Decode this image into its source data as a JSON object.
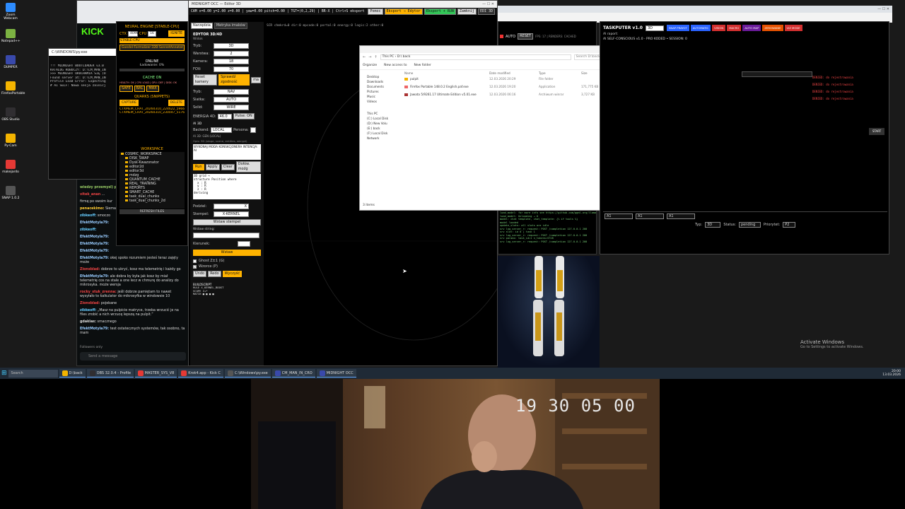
{
  "desktop": {
    "icons": [
      {
        "label": "Zoom Webcam",
        "icon": "camera-icon",
        "color": "#2d8cff"
      },
      {
        "label": "Notepad++",
        "icon": "notepad-icon",
        "color": "#7cb342"
      },
      {
        "label": "DUMPER",
        "icon": "app-icon",
        "color": "#3949ab"
      },
      {
        "label": "FirefoxPortable",
        "icon": "folder-icon",
        "color": "#f4b400"
      },
      {
        "label": "OBS Studio",
        "icon": "obs-icon",
        "color": "#302e31"
      },
      {
        "label": "Py-Cam",
        "icon": "folder-icon",
        "color": "#f4b400"
      },
      {
        "label": "makejardo",
        "icon": "app-icon",
        "color": "#e53935"
      },
      {
        "label": "SNAP 1.0.2",
        "icon": "app-icon",
        "color": "#555555"
      }
    ],
    "activation": {
      "line1": "Activate Windows",
      "line2": "Go to Settings to activate Windows."
    }
  },
  "kick": {
    "logo": "KICK",
    "placeholder": "Send a message",
    "following": "Followers only",
    "messages": [
      {
        "user": "wiedzy przemysl) p",
        "text": "",
        "color": "#9c6"
      },
      {
        "user": "vitek_anan",
        "text": "...",
        "color": "#e44"
      },
      {
        "user": "",
        "text": "firmę po swoim kur",
        "color": "#ddd"
      },
      {
        "user": "penacekimo:",
        "text": "Siema",
        "color": "#fc3"
      },
      {
        "user": "zibkeoff:",
        "text": "smoczo",
        "color": "#6cf"
      },
      {
        "user": "EfektMotyla79:",
        "text": "",
        "color": "#9cf"
      },
      {
        "user": "zibkeoff:",
        "text": "",
        "color": "#6cf"
      },
      {
        "user": "EfektMotyla79:",
        "text": "",
        "color": "#9cf"
      },
      {
        "user": "EfektMotyla79:",
        "text": "",
        "color": "#9cf"
      },
      {
        "user": "EfektMotyla79:",
        "text": "",
        "color": "#9cf"
      },
      {
        "user": "EfektMotyla79:",
        "text": "okej spoko rozumiem jesteś teraz zajęty może",
        "color": "#9cf"
      },
      {
        "user": "Zionsblad:",
        "text": "dobrze to ukryć, kosz ma telemetrię i każdy go",
        "color": "#e44"
      },
      {
        "user": "EfektMotyla79:",
        "text": "ale dobra by była jak kosz by miał telemetrię cos na stale a one lecz w chmurę do analizy do mikrosyka. może wersja",
        "color": "#9cf"
      },
      {
        "user": "rocky_stuk_zrenna:",
        "text": "jeśli dobrze pamiętam to nawet wysyłało to kalkulator do mikrosyfka w windowsie 10",
        "color": "#e44"
      },
      {
        "user": "Zionsblad:",
        "text": "pojebane",
        "color": "#e44"
      },
      {
        "user": "zibkeoff:",
        "text": "„Masz na pulpicie matryce, trzeba wrzucić je na files zrobić a nich wrzucę lepszą na pulpit.”",
        "color": "#6cf"
      },
      {
        "user": "gdaklas:",
        "text": "smacznego",
        "color": "#ddd"
      },
      {
        "user": "EfektMotyla79:",
        "text": "test ostatecznych systemów, tak osobno, ta mam",
        "color": "#9cf"
      }
    ]
  },
  "console": {
    "title": "C:\\WINDOWS\\py.exe",
    "lines": [
      "!!! MIDNIGHT BOOTLOADER v3.0",
      "KATALOG ROBOCZY: D:\\CM_MAN_IN",
      ">>> MIDNIGHT URUCHAMIA SIĘ (O",
      "Found server at: D:\\CM_MAN_IN",
      "Profile Load Error: Expecting",
      "# AI SELF: Nowa sesja zainicj"
    ]
  },
  "neural": {
    "engine_label": "NEURAL ENGINE [STABLE-CPU]",
    "ctx_label": "CTX",
    "ctx_value": "4096",
    "cpu_label": "CPU",
    "cpu_value": "16",
    "stable_label": "STABLE-CPU",
    "ignite_label": "IGNITE",
    "model_value": "Goedel-Formalizer-32B-SonnetAnnotat",
    "status_online": "ONLINE",
    "loading_label": "Ładowanie: 0%",
    "cache_on": "CACHE ON",
    "health_text": "HEALTH: OK | CPU LOAD | GPU: DEF | DISK: OK",
    "safe": "SAFE",
    "bal": "BAL",
    "max": "MAX",
    "quarks_title": "QUARKS (SNIPPETS)",
    "capture": "CAPTURE",
    "delete": "DELETE",
    "quarks": [
      "CTXMEM_CHAT_20260310_224622_5966",
      "CTXMEM_CHAT_20260310_230047_5176"
    ],
    "workspace_title": "WORKSPACE",
    "tree": [
      "COSMIC_WORKSPACE",
      "DISK_SWAP",
      "Dysk-Kwazonator",
      "editor2d",
      "editor3d",
      "mdzg",
      "QUANTUM_CACHE",
      "REAL_TRAINING",
      "REPORTS",
      "SMART_CACHE",
      "task_dual_chunks",
      "task_dual_chunks_2d"
    ],
    "refresh": "REFRESH FILES"
  },
  "editor": {
    "title": "MIDNIGHT OCC — Editor 3D",
    "hud": "CAM x=0.00 y=2.00 z=0.00 | yaw=0.00 pitch=0.00 | TGT=(0,2,29) | BR-X | Ctrl+S eksport",
    "top_buttons": [
      "Pomoc",
      "Eksport → Edytor",
      "Eksport + RUN",
      "Zamknij",
      "EDI 3D"
    ],
    "hud2": "SCR chmkrd=0  dir:0  mpcode:0  portal:0  energy:0  logic:2  other:0",
    "tabs": [
      "Narzędzia",
      "Metryka imaków"
    ],
    "panel_title": "EDYTOR 3D/4D",
    "section_widok": "Widok",
    "tryb_label": "Tryb:",
    "tryb_value": "3D",
    "warstwa_label": "Warstwa:",
    "warstwa_value": "2",
    "kamera_label": "Kamera:",
    "kamera_value": "18",
    "fov_label": "FOV:",
    "fov_value": "70",
    "reset_camera": "Reset kamery",
    "check": "Sprawdź zgodność",
    "more": "ma",
    "tryb2_label": "Tryb:",
    "tryb2_value": "NAV",
    "siatka_label": "Siatka:",
    "siatka_value": "AUTO",
    "solid_label": "Solid:",
    "solid_value": "WIRE",
    "energy_label": "ENERGIA 4D:",
    "energy_value": "46.0",
    "pulse": "Pulse: ON",
    "ai_label": "AI 3D",
    "backend_label": "Backend:",
    "backend_value": "LOCAL",
    "persona_label": "Persona:",
    "ai_status": "AI 3D: GEN (LOCAL)",
    "ai_hint": "Opis: 3D (stage, scene, entities, wkrypt)",
    "ai_prompt": "WYKONAJ MODA KONSKCJONERA INTENCJA: AI",
    "run_buttons": [
      "Run",
      "Apply",
      "Clear",
      "Dołów. moźg"
    ],
    "code_lines": [
      "3D grid →",
      "structure Position where",
      "  x : R",
      "  y : R",
      "  z : R",
      "deriving"
    ],
    "podziel_label": "Podziel:",
    "podziel_value": "X",
    "stempel_label": "Stempel:",
    "stempel_value": "X-KERNEL",
    "wstaw_stempel": "Wstaw stempel",
    "wstaw_string_label": "Wstaw string:",
    "kierunek_label": "Kierunek:",
    "wstaw": "Wstaw",
    "check_ghost": "Ghost Z±1 (G)",
    "check_wzorce": "Wzorce (P)",
    "action_buttons": [
      "Undo",
      "Redo",
      "Wyczyść"
    ],
    "script_title": "BUILDSCRIPT",
    "script_lines": [
      "RULE X_KERNEL_BOOST",
      "SCOPE Z+*",
      "MATCH ■ ■ ■ ■"
    ]
  },
  "explorer": {
    "path": "This PC › D:\\ back",
    "search": "Search D:\\back",
    "ribbon": [
      "Organize",
      "New access to",
      "New folder"
    ],
    "nav": [
      "Desktop",
      "Downloads",
      "Documents",
      "Pictures",
      "Music",
      "Videos",
      "This PC",
      "(C:) Local Disk",
      "(D:) New Volu",
      "(E:) back",
      "(F:) Local Disk",
      "Network"
    ],
    "columns": [
      "Name",
      "Date modified",
      "Type",
      "Size"
    ],
    "files": [
      {
        "name": "pulpit",
        "date": "12.03.2026 20:29",
        "type": "File folder",
        "size": ""
      },
      {
        "name": "Firefox Portable 148.0.2 English.paf.exe",
        "date": "12.03.2026 19:20",
        "type": "Application",
        "size": "171,775 KB"
      },
      {
        "name": "Jawata 5/9261.17 Ultimate Edition v5.01.exe",
        "date": "12.03.2026 06:16",
        "type": "Archiwum winrar",
        "size": "3,727 KB"
      }
    ],
    "status": "3 items"
  },
  "taskputer": {
    "title": "TASKPUTER v1.0",
    "mode": "3D",
    "header_buttons": [
      "SNAP PRAYOT",
      "AUTOMATIC",
      "VISION",
      "MACRO",
      "AUTO MAP",
      "ZEROWANIE",
      "VIZ MODE"
    ],
    "subtitle": "AI SELF-CONSCIOUS v1.0 - PRO KODED • SESSION: 0",
    "label_repo": "AI raport:",
    "btn_start": "START",
    "deny_lines": [
      "DENIED: do rejestrowania",
      "DENIED: do rejestrowania",
      "DENIED: do rejestrowania",
      "DENIED: do rejestrowania"
    ],
    "bottom": {
      "typ_label": "Typ:",
      "typ_value": "3D",
      "status_label": "Status:",
      "status_value": "pending",
      "priorytet_label": "Priorytet:",
      "priorytet_value": "P2"
    },
    "field_tags": [
      "A1",
      "A1",
      "A1"
    ]
  },
  "monitor": {
    "auto_label": "AUTO",
    "reset_label": "RESET",
    "fps": "FPS: 17 | RENDERS: CACHED",
    "log_lines": [
      "load_model: for more info see https://github.com/ggml-org/llama.cpp",
      "load_model: Unloading → 0",
      "model: chat template, chat_template: {% if tools %}",
      "model loaded",
      "update_slots: all slots are idle",
      "srv  log_server_r: request: POST /completion 127.0.0.1 200",
      "srv  slot: id 0 | task 1",
      "srv  log_server_r: request: POST /completion 127.0.0.1 200",
      "srv  params: task_id=1 n_tokens=5728",
      "srv  log_server_r: request: POST /completion 127.0.0.1 200"
    ]
  },
  "webcam": {
    "timestamp": "19 30 05 00"
  },
  "taskbar": {
    "search_placeholder": "Search",
    "items": [
      {
        "label": "D:\\back",
        "color": "#f4b400"
      },
      {
        "label": "OBS 32.0.4 - Profile",
        "color": "#302e31"
      },
      {
        "label": "MASTER_SYS_V8",
        "color": "#e53935"
      },
      {
        "label": "Krok4.app - Kick C",
        "color": "#e53935"
      },
      {
        "label": "C:\\Windows\\py.exe",
        "color": "#555555"
      },
      {
        "label": "CM_MAN_IN_CRO",
        "color": "#3949ab"
      },
      {
        "label": "MIDNIGHT OCC",
        "color": "#3949ab"
      }
    ],
    "time": "20:00",
    "date": "13.03.2026"
  }
}
